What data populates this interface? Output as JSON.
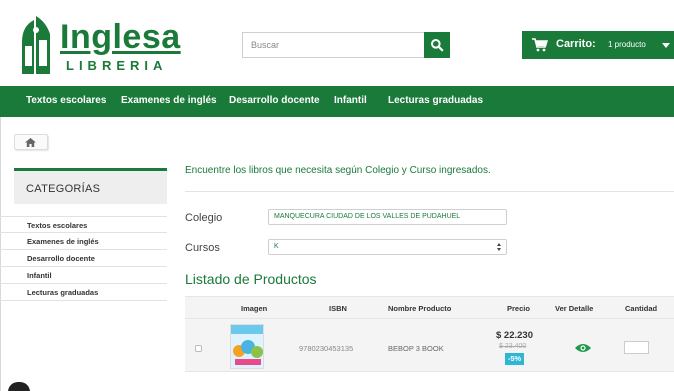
{
  "header": {
    "logo": {
      "main": "Inglesa",
      "sub": "LIBRERIA"
    },
    "search": {
      "placeholder": "Buscar"
    },
    "cart": {
      "label": "Carrito:",
      "count": "1 producto"
    }
  },
  "nav": {
    "items": [
      "Textos escolares",
      "Examenes de inglés",
      "Desarrollo docente",
      "Infantil",
      "Lecturas graduadas"
    ]
  },
  "sidebar": {
    "title": "CATEGORÍAS",
    "items": [
      "Textos escolares",
      "Examenes de inglés",
      "Desarrollo docente",
      "Infantil",
      "Lecturas graduadas"
    ]
  },
  "main": {
    "intro": "Encuentre los libros que necesita según Colegio y Curso ingresados.",
    "colegio": {
      "label": "Colegio",
      "value": "MANQUECURA CIUDAD DE LOS VALLES DE PUDAHUEL"
    },
    "cursos": {
      "label": "Cursos",
      "value": "K"
    },
    "list_title": "Listado de Productos",
    "table": {
      "headers": [
        "Imagen",
        "ISBN",
        "Nombre Producto",
        "Precio",
        "Ver Detalle",
        "Cantidad"
      ],
      "rows": [
        {
          "isbn": "9780230453135",
          "name": "BEBOP 3 BOOK",
          "price": "$ 22.230",
          "old_price": "$ 23.400",
          "discount": "-5%"
        }
      ]
    }
  },
  "colors": {
    "brand_green": "#1a7a3a",
    "discount_badge": "#2eb6d5"
  },
  "icons": [
    "logo-emblem-icon",
    "search-icon",
    "cart-icon",
    "chevron-down-icon",
    "home-icon",
    "eye-icon"
  ]
}
